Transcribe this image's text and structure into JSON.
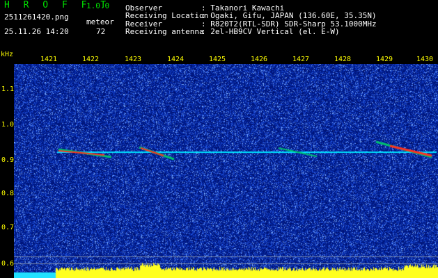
{
  "app": {
    "title": "H R O F F T",
    "version": "1.0.0",
    "filename": "2511261420.png",
    "datetime": "25.11.26 14:20",
    "meteor_label": "meteor",
    "meteor_count": "72"
  },
  "info": [
    {
      "label": "Observer",
      "value": ": Takanori Kawachi"
    },
    {
      "label": "Receiving Location",
      "value": ": Ogaki, Gifu, JAPAN (136.60E, 35.35N)"
    },
    {
      "label": "Receiver",
      "value": ": R820T2(RTL-SDR) SDR-Sharp 53.1000MHz"
    },
    {
      "label": "Receiving antenna",
      "value": ": 2el-HB9CV Vertical (el. E-W)"
    }
  ],
  "axes": {
    "y_unit": "kHz",
    "y_ticks": [
      "1.1",
      "1.0",
      "0.9",
      "0.8",
      "0.7",
      "0.6"
    ],
    "x_ticks": [
      "1421",
      "1422",
      "1423",
      "1424",
      "1425",
      "1426",
      "1427",
      "1428",
      "1429",
      "1430"
    ]
  },
  "colors": {
    "background": "#000000",
    "noise_dark": "#00107a",
    "noise_bright": "#3a6aff",
    "signal_line": "#00e0ff",
    "meteor_hot": "#ff3020",
    "bottom_fill": "#ffff20",
    "text_green": "#00e000"
  }
}
